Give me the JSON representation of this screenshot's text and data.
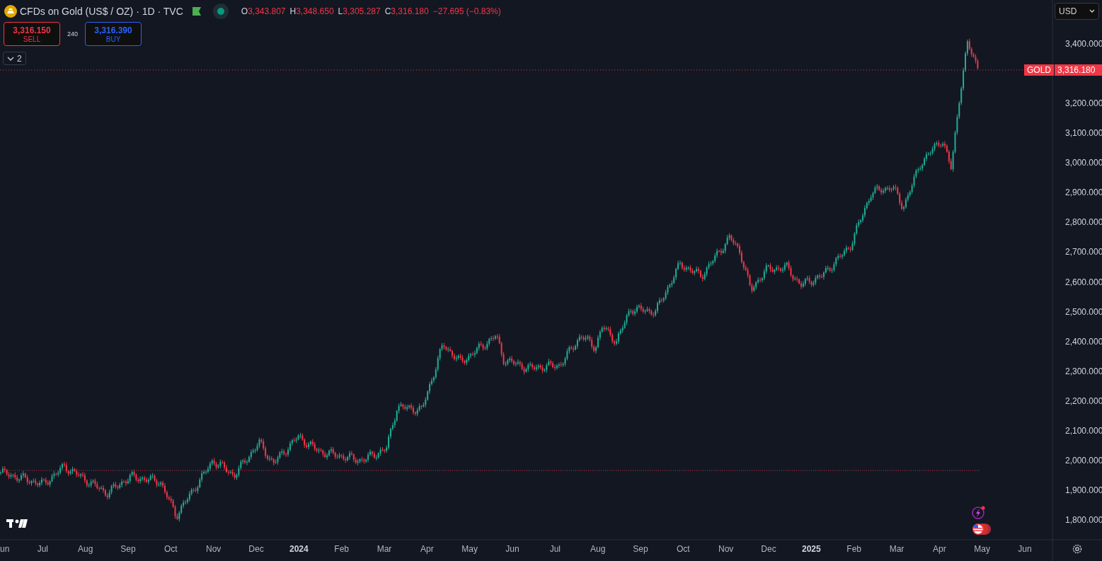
{
  "header": {
    "symbol": "CFDs on Gold (US$ / OZ) · 1D · TVC",
    "ohlc": [
      {
        "label": "O",
        "value": "3,343.807"
      },
      {
        "label": "H",
        "value": "3,348.650"
      },
      {
        "label": "L",
        "value": "3,305.287"
      },
      {
        "label": "C",
        "value": "3,316.180"
      }
    ],
    "change": "−27.695 (−0.83%)"
  },
  "trade": {
    "sell": {
      "price": "3,316.150",
      "label": "SELL"
    },
    "spread": "240",
    "buy": {
      "price": "3,316.390",
      "label": "BUY"
    }
  },
  "indicators_toggle": "2",
  "currency": "USD",
  "price_label": {
    "name": "GOLD",
    "value": "3,316.180"
  },
  "time_axis": [
    "un",
    "Jul",
    "Aug",
    "Sep",
    "Oct",
    "Nov",
    "Dec",
    "2024",
    "Feb",
    "Mar",
    "Apr",
    "May",
    "Jun",
    "Jul",
    "Aug",
    "Sep",
    "Oct",
    "Nov",
    "Dec",
    "2025",
    "Feb",
    "Mar",
    "Apr",
    "May",
    "Jun"
  ],
  "price_axis": [
    "3,400.000",
    "3,200.000",
    "3,100.000",
    "3,000.000",
    "2,900.000",
    "2,800.000",
    "2,700.000",
    "2,600.000",
    "2,500.000",
    "2,400.000",
    "2,300.000",
    "2,200.000",
    "2,100.000",
    "2,000.000",
    "1,900.000",
    "1,800.000"
  ]
}
